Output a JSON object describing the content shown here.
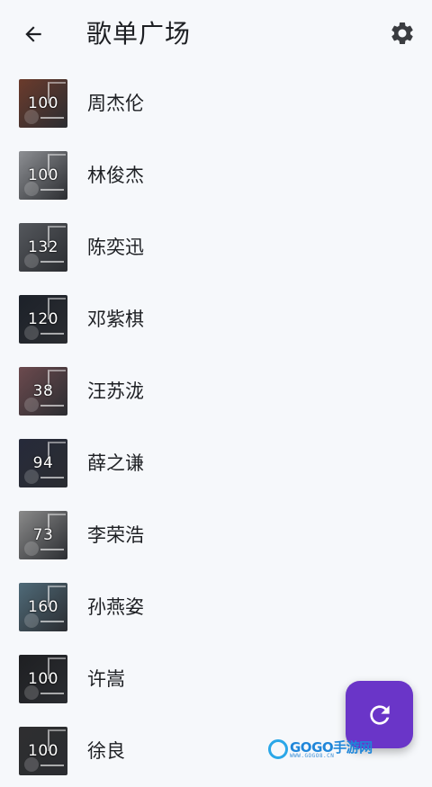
{
  "appbar": {
    "title": "歌单广场",
    "back_icon": "arrow-left-icon",
    "settings_icon": "gear-icon"
  },
  "playlists": [
    {
      "name": "周杰伦",
      "count": "100",
      "thumb_color": "#6b3b2c"
    },
    {
      "name": "林俊杰",
      "count": "100",
      "thumb_color": "#8d8f93"
    },
    {
      "name": "陈奕迅",
      "count": "132",
      "thumb_color": "#54575c"
    },
    {
      "name": "邓紫棋",
      "count": "120",
      "thumb_color": "#1c2129"
    },
    {
      "name": "汪苏泷",
      "count": "38",
      "thumb_color": "#6c4a4e"
    },
    {
      "name": "薛之谦",
      "count": "94",
      "thumb_color": "#262a3a"
    },
    {
      "name": "李荣浩",
      "count": "73",
      "thumb_color": "#8a8a8a"
    },
    {
      "name": "孙燕姿",
      "count": "160",
      "thumb_color": "#4f6a78"
    },
    {
      "name": "许嵩",
      "count": "100",
      "thumb_color": "#1e1f22"
    },
    {
      "name": "徐良",
      "count": "100",
      "thumb_color": "#2e2e30"
    }
  ],
  "fab": {
    "icon": "refresh-icon",
    "color": "#6a35c8"
  },
  "watermark": {
    "text": "GOGO手游网",
    "sub": "WWW.GOGO8.CN"
  }
}
